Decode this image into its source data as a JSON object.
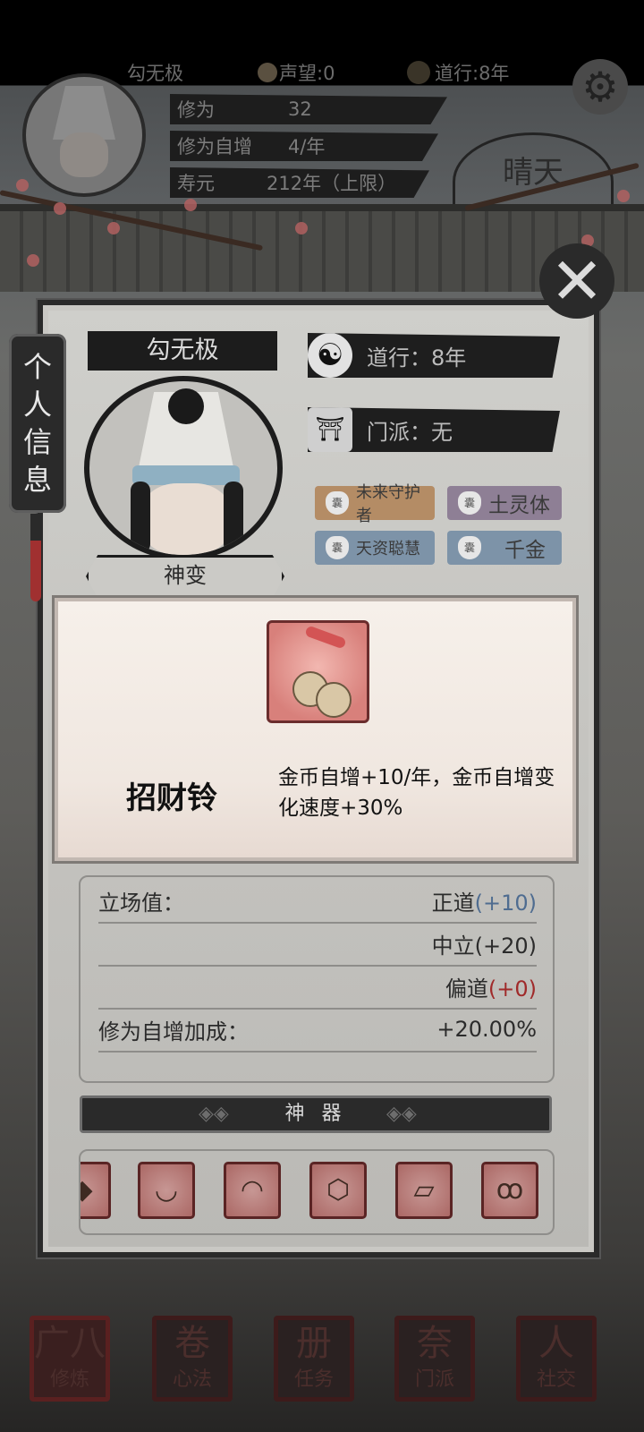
{
  "top": {
    "player_name": "勾无极",
    "reputation": "声望:0",
    "dao_years": "道行:8年",
    "cultivation_label": "修为",
    "cultivation_value": "32",
    "growth_label": "修为自增",
    "growth_value": "4/年",
    "lifespan_label": "寿元",
    "lifespan_value": "212年（上限）",
    "weather": "晴天"
  },
  "side_tab": [
    "个",
    "人",
    "信",
    "息"
  ],
  "profile": {
    "name": "勾无极",
    "realm": "神变",
    "dao_line": "道行：8年",
    "sect_line": "门派：无",
    "tags": [
      {
        "text": "未来守护者",
        "color": "#b48c65"
      },
      {
        "text": "土灵体",
        "color": "#8e7f95"
      },
      {
        "text": "天资聪慧",
        "color": "#7d93a8"
      },
      {
        "text": "千金",
        "color": "#7d93a8"
      }
    ]
  },
  "tooltip": {
    "item_name": "招财铃",
    "description": "金币自增+10/年，金币自增变化速度+30%"
  },
  "stats": {
    "stance_label": "立场值：",
    "stance_righteous": "正道",
    "stance_righteous_value": "(+10)",
    "stance_neutral": "中立(+20)",
    "stance_evil": "偏道",
    "stance_evil_value": "(+0)",
    "growth_bonus_label": "修为自增加成：",
    "growth_bonus_value": "+20.00%"
  },
  "artifacts_header": "神 器",
  "nav": [
    {
      "label": "修炼",
      "glyph": "广八"
    },
    {
      "label": "心法",
      "glyph": "卷"
    },
    {
      "label": "任务",
      "glyph": "册"
    },
    {
      "label": "门派",
      "glyph": "奈"
    },
    {
      "label": "社交",
      "glyph": "人"
    }
  ]
}
